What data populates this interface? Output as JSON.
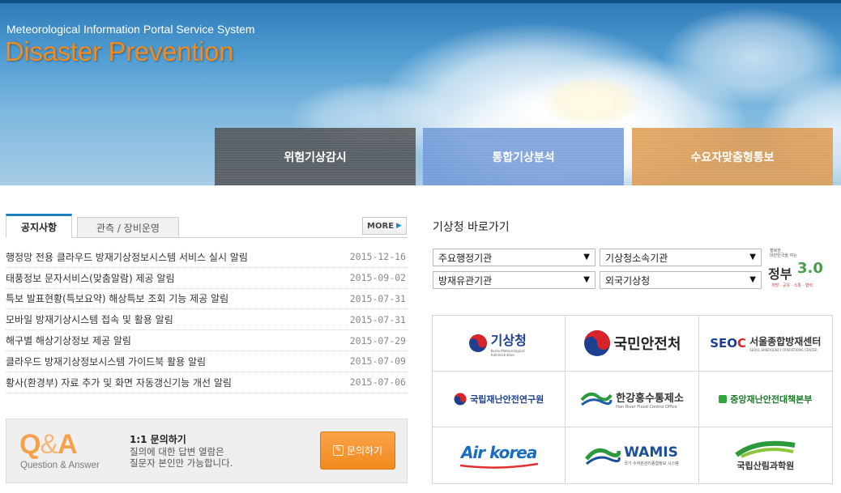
{
  "header": {
    "subtitle": "Meteorological Information Portal Service System",
    "title": "Disaster Prevention",
    "nav": [
      "위험기상감시",
      "통합기상분석",
      "수요자맞춤형통보"
    ]
  },
  "notice": {
    "tabs": [
      "공지사항",
      "관측 / 장비운영"
    ],
    "more": "MORE",
    "items": [
      {
        "title": "행정망 전용 클라우드 방재기상정보시스템 서비스 실시 알림",
        "date": "2015-12-16"
      },
      {
        "title": "태풍정보 문자서비스(맞춤알람) 제공 알림",
        "date": "2015-09-02"
      },
      {
        "title": "특보 발표현황(특보요약) 해상특보 조회 기능 제공 알림",
        "date": "2015-07-31"
      },
      {
        "title": "모바일 방재기상시스템 접속 및 활용 알림",
        "date": "2015-07-31"
      },
      {
        "title": "해구별 해상기상정보 제공 알림",
        "date": "2015-07-29"
      },
      {
        "title": "클라우드 방재기상정보시스템 가이드북 활용 알림",
        "date": "2015-07-09"
      },
      {
        "title": "황사(환경부) 자료 추가 및 화면 자동갱신기능 개선 알림",
        "date": "2015-07-06"
      }
    ]
  },
  "qa": {
    "q": "Q",
    "amp": "&",
    "a": "A",
    "caption": "Question & Answer",
    "heading": "1:1 문의하기",
    "line1": "질의에 대한 답변 열람은",
    "line2": "질문자 본인만 가능합니다.",
    "button": "문의하기"
  },
  "shortcuts": {
    "title": "기상청 바로가기",
    "selects": [
      "주요행정기관",
      "기상청소속기관",
      "방재유관기관",
      "외국기상청"
    ],
    "gov": {
      "small1": "행복한",
      "small2": "대한민국을 여는",
      "big": "정부",
      "num": "3.0",
      "foot": "개방 · 공유 · 소통 · 협력"
    },
    "logos": [
      {
        "name": "기상청",
        "sub": "Korea Meteorological Administration",
        "color": "#1c3f8f"
      },
      {
        "name": "국민안전처",
        "sub": "",
        "color": "#222222"
      },
      {
        "name": "서울종합방재센터",
        "sub": "SEOUL EMERGENCY OPERATIONS CENTER",
        "color": "#222222"
      },
      {
        "name": "국립재난안전연구원",
        "sub": "",
        "color": "#1c3f8f"
      },
      {
        "name": "한강홍수통제소",
        "sub": "Han River Flood Control Office",
        "color": "#222222"
      },
      {
        "name": "중앙재난안전대책본부",
        "sub": "",
        "color": "#1a7a2a"
      },
      {
        "name": "Air korea",
        "sub": "",
        "color": "#1a6cc0"
      },
      {
        "name": "WAMIS",
        "sub": "국가 수자원관리종합정보 시스템",
        "color": "#1a4f9a"
      },
      {
        "name": "국립산림과학원",
        "sub": "",
        "color": "#333333"
      }
    ]
  }
}
